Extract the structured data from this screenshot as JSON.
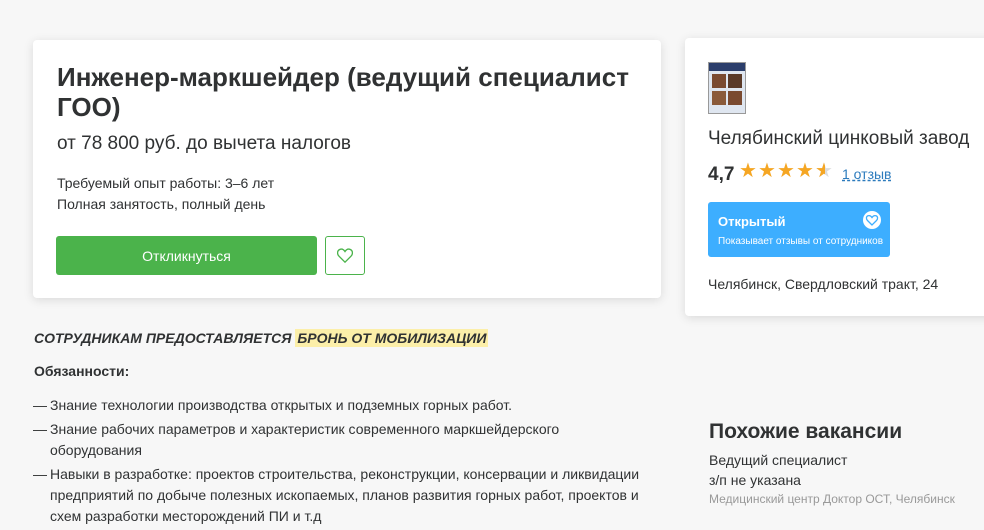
{
  "vacancy": {
    "title": "Инженер-маркшейдер (ведущий специалист ГОО)",
    "salary": "от 78 800 руб. до вычета налогов",
    "experience": "Требуемый опыт работы: 3–6 лет",
    "employment": "Полная занятость, полный день",
    "respond_label": "Откликнуться"
  },
  "company": {
    "name": "Челябинский цинковый завод",
    "rating": "4,7",
    "rating_value": 4.7,
    "reviews": "1 отзыв",
    "badge_title": "Открытый",
    "badge_desc": "Показывает отзывы от сотрудников",
    "address": "Челябинск, Свердловский тракт, 24"
  },
  "description": {
    "mobilization_prefix": "СОТРУДНИКАМ ПРЕДОСТАВЛЯЕТСЯ",
    "mobilization_highlight": "БРОНЬ ОТ МОБИЛИЗАЦИИ",
    "duties_heading": "Обязанности:",
    "duties": [
      "Знание технологии производства открытых и подземных горных работ.",
      "Знание рабочих параметров и характеристик современного маркшейдерского оборудования",
      "Навыки в разработке: проектов строительства, реконструкции, консервации и ликвидации предприятий по добыче полезных ископаемых, планов развития горных работ, проектов и схем разработки месторождений ПИ и т.д"
    ]
  },
  "similar": {
    "heading": "Похожие вакансии",
    "items": [
      {
        "title": "Ведущий специалист",
        "salary": "з/п не указана",
        "company": "Медицинский центр Доктор ОСТ, Челябинск"
      }
    ]
  },
  "colors": {
    "primary_green": "#4bb34b",
    "badge_blue": "#3daeff",
    "star": "#f5a623",
    "link": "#2c7bbd",
    "highlight": "#fcefa9"
  }
}
